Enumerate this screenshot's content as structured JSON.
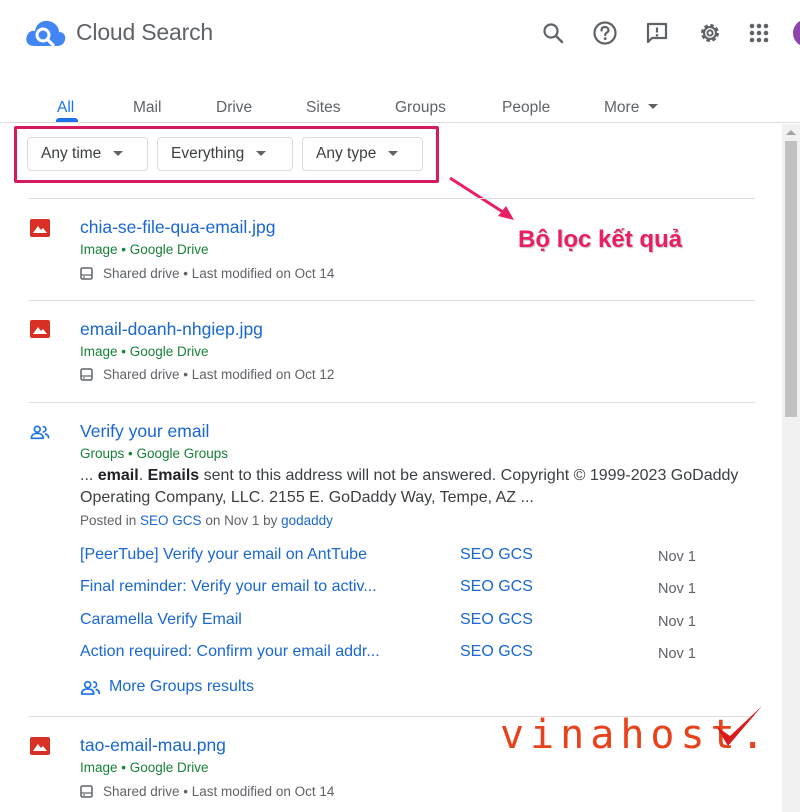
{
  "header": {
    "app_title": "Cloud Search",
    "icons": [
      "search-icon",
      "help-icon",
      "feedback-icon",
      "settings-icon",
      "apps-icon"
    ]
  },
  "tabs": [
    {
      "label": "All",
      "active": true
    },
    {
      "label": "Mail"
    },
    {
      "label": "Drive"
    },
    {
      "label": "Sites"
    },
    {
      "label": "Groups"
    },
    {
      "label": "People"
    },
    {
      "label": "More"
    }
  ],
  "filters": [
    {
      "label": "Any time"
    },
    {
      "label": "Everything"
    },
    {
      "label": "Any type"
    }
  ],
  "annotation": "Bộ lọc kết quả",
  "results": [
    {
      "title": "chia-se-file-qua-email.jpg",
      "source": "Image • Google Drive",
      "meta": "Shared drive • Last modified on Oct 14"
    },
    {
      "title": "email-doanh-nhgiep.jpg",
      "source": "Image • Google Drive",
      "meta": "Shared drive • Last modified on Oct 12"
    },
    {
      "title": "Verify your email",
      "source": "Groups • Google Groups",
      "snippet": {
        "prefix": "... ",
        "bold1": "email",
        "sep": ". ",
        "bold2": "Emails",
        "rest": " sent to this address will not be answered. Copyright © 1999-2023 GoDaddy Operating Company, LLC. 2155 E. GoDaddy Way, Tempe, AZ ..."
      },
      "posted": {
        "prefix": "Posted in ",
        "group": "SEO GCS",
        "mid": " on Nov 1 by ",
        "author": "godaddy"
      },
      "sub_results": [
        {
          "title": "[PeerTube] Verify your email on AntTube",
          "group": "SEO GCS",
          "date": "Nov 1"
        },
        {
          "title": "Final reminder: Verify your email to activ...",
          "group": "SEO GCS",
          "date": "Nov 1"
        },
        {
          "title": "Caramella Verify Email",
          "group": "SEO GCS",
          "date": "Nov 1"
        },
        {
          "title": "Action required: Confirm your email addr...",
          "group": "SEO GCS",
          "date": "Nov 1"
        }
      ],
      "more_link": "More Groups results"
    },
    {
      "title": "tao-email-mau.png",
      "source": "Image • Google Drive",
      "meta": "Shared drive • Last modified on Oct 14"
    }
  ],
  "watermark": "vinahost."
}
